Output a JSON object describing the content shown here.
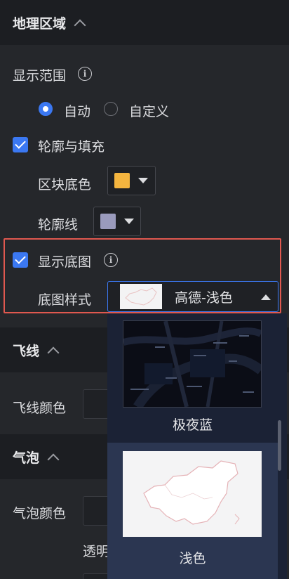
{
  "geo_section": {
    "title": "地理区域",
    "display_range": {
      "label": "显示范围",
      "options": [
        {
          "label": "自动",
          "selected": true
        },
        {
          "label": "自定义",
          "selected": false
        }
      ]
    },
    "outline_fill": {
      "label": "轮廓与填充",
      "checked": true,
      "block_color": {
        "label": "区块底色",
        "value": "#f4b53f"
      },
      "outline_color": {
        "label": "轮廓线",
        "value": "#9a9bbd"
      }
    },
    "base_map": {
      "label": "显示底图",
      "checked": true,
      "style_label": "底图样式",
      "style_value": "高德-浅色",
      "options": [
        {
          "label": "极夜蓝"
        },
        {
          "label": "浅色"
        }
      ]
    }
  },
  "flyline_section": {
    "title": "飞线",
    "color_label": "飞线颜色"
  },
  "bubble_section": {
    "title": "气泡",
    "color_label": "气泡颜色",
    "opacity_label": "透明"
  },
  "colors": {
    "accent": "#3b78f2",
    "highlight": "#e0584f",
    "panel_bg": "#25272b",
    "header_bg": "#1c1e22"
  }
}
